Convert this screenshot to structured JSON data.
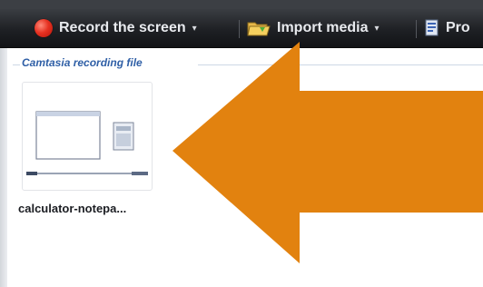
{
  "toolbar": {
    "record_label": "Record the screen",
    "import_label": "Import media",
    "produce_label": "Pro",
    "caret": "▾"
  },
  "group": {
    "title": "Camtasia recording file"
  },
  "clips": [
    {
      "name": "calculator-notepa..."
    }
  ],
  "icons": {
    "record": "record-icon",
    "import": "folder-icon",
    "produce": "project-icon",
    "overlay": "arrow-left"
  },
  "colors": {
    "arrow": "#e2820f",
    "group_title": "#2f5fa6",
    "toolbar_bg": "#1e2024",
    "record_red": "#e63222"
  }
}
